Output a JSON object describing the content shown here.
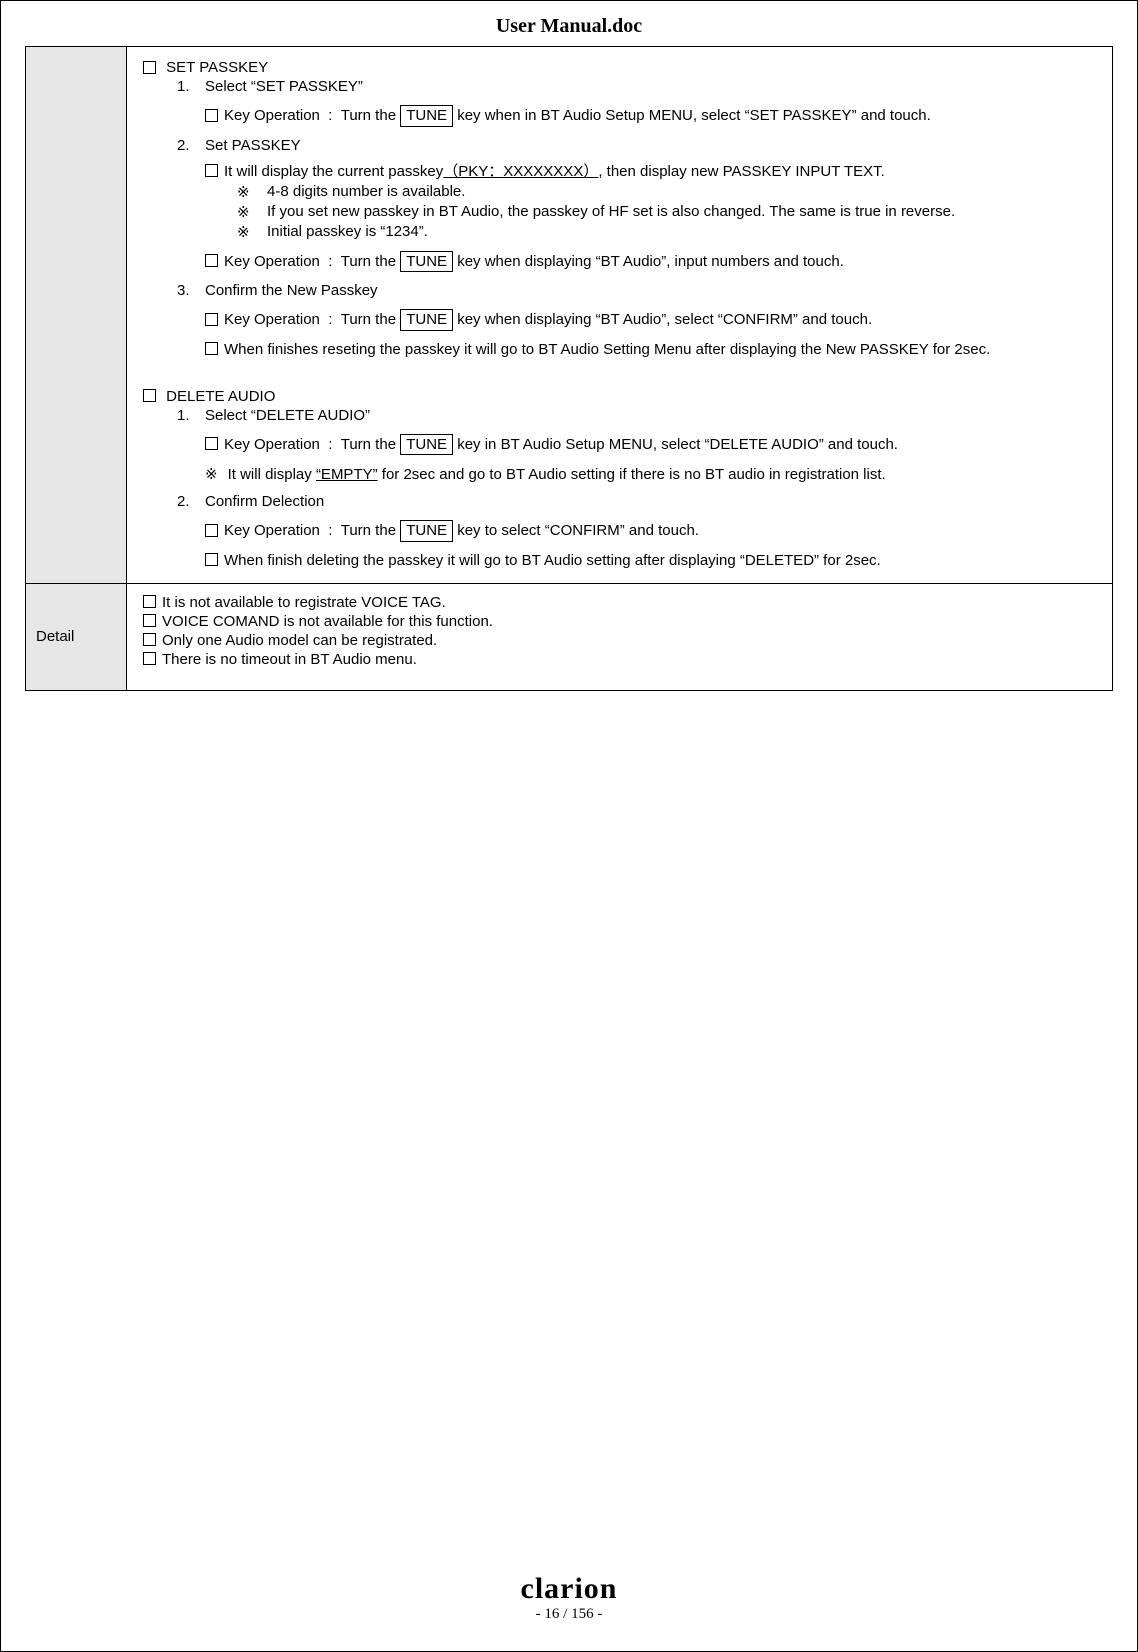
{
  "title": "User Manual.doc",
  "section1": {
    "head": "SET PASSKEY",
    "s1_num": "1.",
    "s1_txt": "Select “SET PASSKEY”",
    "s1_key_a": "Key Operation  :  Turn the ",
    "s1_key_b": " key when in BT Audio Setup MENU, select “SET PASSKEY” and touch.",
    "s2_num": "2.",
    "s2_txt": "Set PASSKEY",
    "s2_line_a": "It will display the current passkey",
    "s2_line_b": ", then display new PASSKEY INPUT TEXT.",
    "s2_pky": "（PKY：XXXXXXXX）",
    "note_mark": "※",
    "s2_n1": "4-8 digits number is available.",
    "s2_n2": "If you set new passkey in BT Audio, the passkey of HF set is also changed. The same is true in reverse.",
    "s2_n3": "Initial passkey is “1234”.",
    "s2_key_a": "Key Operation  :  Turn the ",
    "s2_key_b": " key when displaying “BT Audio”, input numbers and touch.",
    "s3_num": "3.",
    "s3_txt": "Confirm the New Passkey",
    "s3_key_a": "Key Operation  :  Turn the ",
    "s3_key_b": " key when displaying “BT Audio”, select “CONFIRM” and touch.",
    "s3_fin": "When finishes reseting the passkey it will go to BT Audio Setting Menu after displaying the New PASSKEY for 2sec."
  },
  "section2": {
    "head": "DELETE AUDIO",
    "d1_num": "1.",
    "d1_txt": "Select “DELETE AUDIO”",
    "d1_key_a": "Key Operation  :  Turn the ",
    "d1_key_b": " key in BT Audio Setup MENU, select “DELETE AUDIO” and touch.",
    "d1_note_a": "It will display ",
    "d1_note_b": " for 2sec and go to BT Audio setting if there is no BT audio in registration list.",
    "d1_empty": "“EMPTY”",
    "d2_num": "2.",
    "d2_txt": "Confirm Delection",
    "d2_key_a": "Key Operation  :  Turn the ",
    "d2_key_b": " key to select “CONFIRM” and touch.",
    "d2_fin": "When finish deleting the passkey it will go to BT Audio setting after displaying “DELETED” for 2sec."
  },
  "tune": "TUNE",
  "detail": {
    "label": "Detail",
    "l1": "It is not available to registrate VOICE TAG.",
    "l2": "VOICE COMAND is not available for this function.",
    "l3": "Only one Audio model can be registrated.",
    "l4": "There is no timeout in BT Audio menu."
  },
  "footer": {
    "brand": "clarion",
    "page": "- 16 / 156 -"
  }
}
